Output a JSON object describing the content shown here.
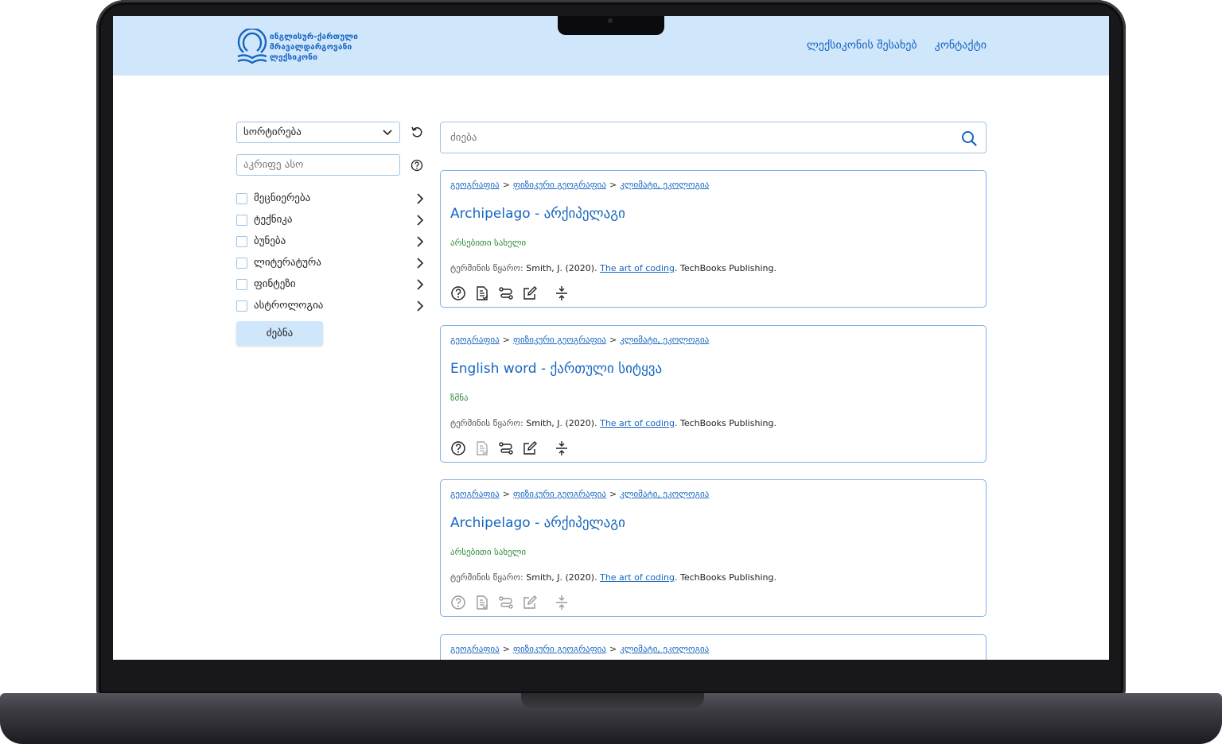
{
  "header": {
    "logo_lines": [
      "ინგლისურ-ქართული",
      "მრავალდარგოვანი",
      "ლექსიკონი"
    ],
    "nav": [
      "ლექსიკონის შესახებ",
      "კონტაქტი"
    ]
  },
  "sidebar": {
    "sort_label": "სორტირება",
    "letter_placeholder": "აკრიფე ასო",
    "categories": [
      "მეცნიერება",
      "ტექნიკა",
      "ბუნება",
      "ლიტერატურა",
      "ფინტეზი",
      "ასტროლოგია"
    ],
    "search_button": "ძებნა"
  },
  "search": {
    "placeholder": "ძიება"
  },
  "cards": [
    {
      "breadcrumb": [
        "გეოგრაფია",
        "ფიზიკური გეოგრაფია",
        "კლიმატი, ეკოლოგია"
      ],
      "title": "Archipelago - არქიპელაგი",
      "pos": "არსებითი სახელი",
      "source_label": "ტერმინის წყარო:",
      "source_pre": "Smith, J. (2020).",
      "source_link": "The art of coding",
      "source_post": ". TechBooks Publishing."
    },
    {
      "breadcrumb": [
        "გეოგრაფია",
        "ფიზიკური გეოგრაფია",
        "კლიმატი, ეკოლოგია"
      ],
      "title": "English word - ქართული სიტყვა",
      "pos": "ზმნა",
      "source_label": "ტერმინის წყარო:",
      "source_pre": "Smith, J. (2020).",
      "source_link": "The art of coding",
      "source_post": ". TechBooks Publishing."
    },
    {
      "breadcrumb": [
        "გეოგრაფია",
        "ფიზიკური გეოგრაფია",
        "კლიმატი, ეკოლოგია"
      ],
      "title": "Archipelago - არქიპელაგი",
      "pos": "არსებითი სახელი",
      "source_label": "ტერმინის წყარო:",
      "source_pre": "Smith, J. (2020).",
      "source_link": "The art of coding",
      "source_post": ". TechBooks Publishing."
    },
    {
      "breadcrumb": [
        "გეოგრაფია",
        "ფიზიკური გეოგრაფია",
        "კლიმატი, ეკოლოგია"
      ]
    }
  ],
  "card_icons": [
    "help-icon",
    "document-icon",
    "route-icon",
    "edit-icon",
    "expand-icon"
  ],
  "colors": {
    "header_bg": "#cfe6fb",
    "accent": "#1565c0",
    "pos_green": "#2e8b3a",
    "border": "#7fb2e5"
  }
}
